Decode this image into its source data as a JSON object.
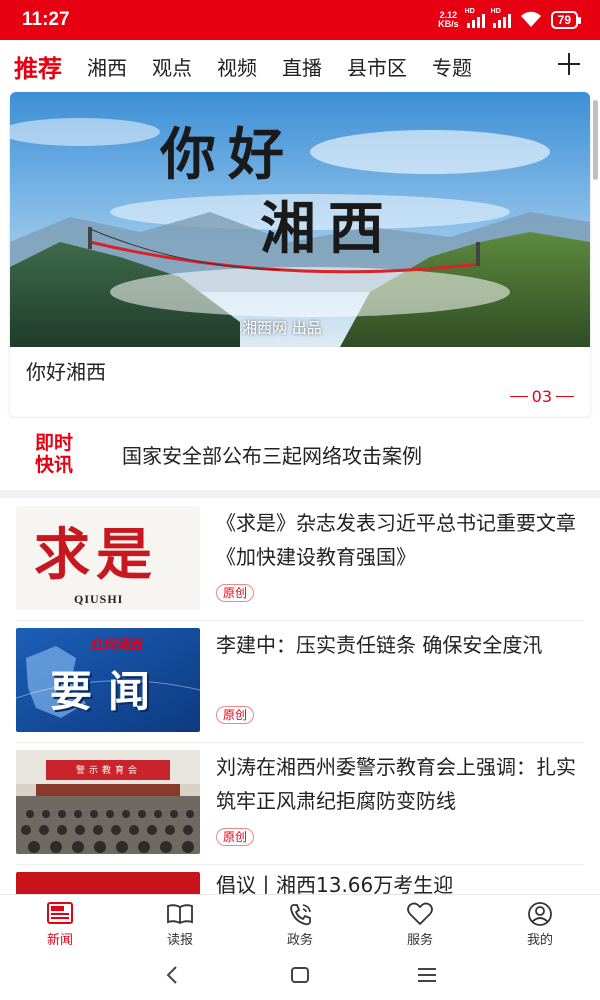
{
  "status_bar": {
    "time": "11:27",
    "net_speed_value": "2.12",
    "net_speed_unit": "KB/s",
    "battery": "79",
    "hd_label": "HD"
  },
  "tabs": [
    {
      "label": "推荐",
      "active": true
    },
    {
      "label": "湘西"
    },
    {
      "label": "观点"
    },
    {
      "label": "视频"
    },
    {
      "label": "直播"
    },
    {
      "label": "县市区"
    },
    {
      "label": "专题"
    }
  ],
  "banner": {
    "image_line1": "你好",
    "image_line2": "湘西",
    "credit": "湘西网 出品",
    "caption": "你好湘西",
    "page": "03"
  },
  "flash": {
    "label_line1": "即时",
    "label_line2": "快讯",
    "text": "国家安全部公布三起网络攻击案例"
  },
  "news": [
    {
      "title": "《求是》杂志发表习近平总书记重要文章《加快建设教育强国》",
      "tag": "原创",
      "thumb_text": "求是",
      "thumb_sub": "QIUSHI"
    },
    {
      "title": "李建中：压实责任链条 确保安全度汛",
      "tag": "原创",
      "thumb_text": "要闻",
      "thumb_sub": "红网湘西"
    },
    {
      "title": "刘涛在湘西州委警示教育会上强调：扎实筑牢正风肃纪拒腐防变防线",
      "tag": "原创",
      "thumb_banner": "警示教育会"
    },
    {
      "title": "倡议丨湘西13.66万考生迎"
    }
  ],
  "bottom_nav": [
    {
      "label": "新闻",
      "icon": "newspaper-icon",
      "active": true
    },
    {
      "label": "读报",
      "icon": "paper-reader-icon"
    },
    {
      "label": "政务",
      "icon": "phone-icon"
    },
    {
      "label": "服务",
      "icon": "heart-icon"
    },
    {
      "label": "我的",
      "icon": "user-icon"
    }
  ],
  "colors": {
    "brand": "#e60012"
  }
}
